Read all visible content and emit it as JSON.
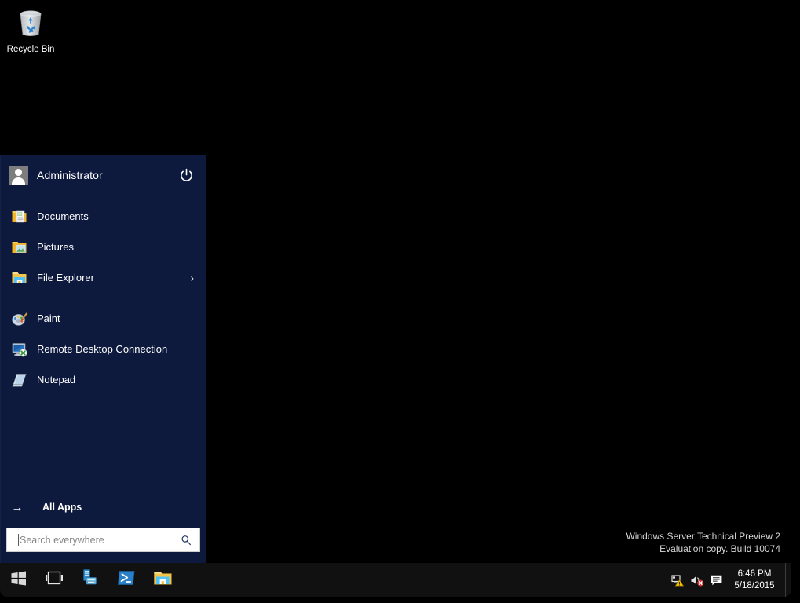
{
  "desktop": {
    "icons": [
      {
        "name": "recycle-bin",
        "label": "Recycle Bin"
      }
    ],
    "watermark": {
      "line1": "Windows Server Technical Preview 2",
      "line2": "Evaluation copy. Build 10074"
    },
    "background_color": "#000000"
  },
  "start_menu": {
    "panel_color": "#0d1a3e",
    "user": {
      "name": "Administrator",
      "avatar_icon": "user-avatar-icon",
      "power_icon": "power-icon"
    },
    "places": [
      {
        "label": "Documents",
        "icon": "documents-folder-icon",
        "has_submenu": false
      },
      {
        "label": "Pictures",
        "icon": "pictures-folder-icon",
        "has_submenu": false
      },
      {
        "label": "File Explorer",
        "icon": "file-explorer-icon",
        "has_submenu": true,
        "chevron": "›"
      }
    ],
    "apps": [
      {
        "label": "Paint",
        "icon": "paint-icon",
        "has_submenu": false
      },
      {
        "label": "Remote Desktop Connection",
        "icon": "remote-desktop-icon",
        "has_submenu": false
      },
      {
        "label": "Notepad",
        "icon": "notepad-icon",
        "has_submenu": false
      }
    ],
    "all_apps": {
      "label": "All Apps",
      "arrow": "→",
      "icon": "arrow-right-icon"
    },
    "search": {
      "placeholder": "Search everywhere",
      "value": "",
      "icon": "search-icon"
    }
  },
  "taskbar": {
    "background_color": "#111111",
    "buttons": [
      {
        "name": "start-button",
        "icon": "windows-logo-icon",
        "tooltip": "Start"
      },
      {
        "name": "task-view-button",
        "icon": "task-view-icon",
        "tooltip": "Task View"
      }
    ],
    "apps": [
      {
        "name": "server-manager",
        "icon": "server-manager-icon",
        "label": "Server Manager"
      },
      {
        "name": "windows-powershell",
        "icon": "powershell-icon",
        "label": "Windows PowerShell"
      },
      {
        "name": "file-explorer",
        "icon": "file-explorer-taskbar-icon",
        "label": "File Explorer"
      }
    ],
    "tray": [
      {
        "name": "network-warning",
        "icon": "network-warning-icon"
      },
      {
        "name": "volume-muted",
        "icon": "volume-muted-icon"
      },
      {
        "name": "action-center",
        "icon": "action-center-icon"
      }
    ],
    "clock": {
      "time": "6:46 PM",
      "date": "5/18/2015"
    },
    "show_desktop": {
      "name": "show-desktop-button"
    }
  }
}
